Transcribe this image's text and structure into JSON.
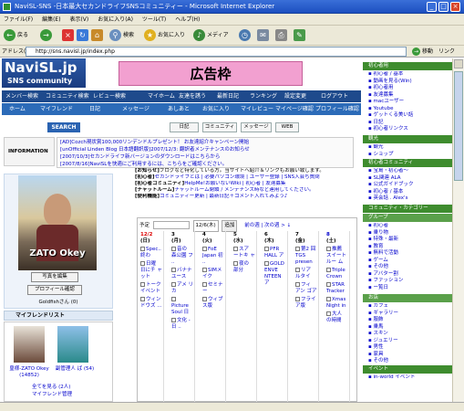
{
  "window": {
    "title": "NaviSL-SNS -日本最大セカンドライフSNSコミュニティー - Microsoft Internet Explorer"
  },
  "menu": [
    "ファイル(F)",
    "編集(E)",
    "表示(V)",
    "お気に入り(A)",
    "ツール(T)",
    "ヘルプ(H)"
  ],
  "toolbar": {
    "back": "戻る",
    "search": "検索",
    "favorites": "お気に入り",
    "media": "メディア"
  },
  "address": {
    "label": "アドレス(D)",
    "value": "http://sns.navisl.jp/index.php",
    "go": "移動",
    "links": "リンク"
  },
  "logo": {
    "title": "NaviSL.jp",
    "subtitle": "SNS community"
  },
  "ad": {
    "label": "広告枠"
  },
  "nav1": [
    "メンバー検索",
    "コミュニティ検索",
    "レビュー検索",
    "マイホーム",
    "友達を誘う",
    "最新日記",
    "ランキング",
    "設定変更",
    "ログアウト"
  ],
  "nav2": [
    "ホーム",
    "マイフレンド",
    "日記",
    "メッセージ",
    "あしあと",
    "お気に入り",
    "マイレビュー",
    "マイページ確認",
    "プロフィール確認"
  ],
  "search": {
    "button": "SEARCH",
    "tabs": [
      "日記",
      "コミュニティ",
      "メッセージ",
      "WEB"
    ]
  },
  "info": {
    "label": "INFORMATION"
  },
  "news": [
    "[AD]Cozch現状賞100,000リンデンドルプレゼント！ お友達紹介キャンペーン開始",
    "[unOfficial Linden Blog 日本語翻訳版]2007/12/3: 翻訳者メンテナンスのお知らせ",
    "[2007/10/3]セカンドライフ新バージョンのダウンロードはこちらから",
    "[2007/8/16]NaviSLを快適にご利用するには、こちらをご確認ください。"
  ],
  "profile": {
    "name": "ZATO Okey",
    "edit_photo": "写真を編集",
    "edit_profile": "プロフィール確認",
    "owner": "Goldfishさん (0)"
  },
  "friends": {
    "header": "マイフレンドリスト",
    "items": [
      {
        "label": "皇様-ZATO Okey (14852)"
      },
      {
        "label": "副管理人 ば (54)"
      }
    ],
    "see_all": "全てを見る (2人)",
    "manage": "マイフレンド管理"
  },
  "intro": [
    {
      "prefix": "[お知らせ]",
      "text": "ブログなど特化している方。当サイトへ紹介＆リンクもお願い致します。"
    },
    {
      "prefix": "[初心者]",
      "text": "セカンドライフとは | 必要パソコン環境 | ユーザー登録 | SNS入会ち質問"
    },
    {
      "prefix": "[初心者コミュニティ]",
      "text": "HelpMe!お願いないWiki | 初心者 | 友達募集"
    },
    {
      "prefix": "[チャットルーム]",
      "text": "チャットルーム閉鎖 / メンテナンス時など連用してください。"
    },
    {
      "prefix": "[便利機能]",
      "text": "コミュニティー更新 | 最新日記＋コメント入れてみよう♪"
    }
  ],
  "calendar": {
    "label": "予定",
    "select": "12/6(木)",
    "add": "追加",
    "nav": "前の週 | 次の週 > ↓",
    "days": [
      {
        "date": "12/2",
        "dow": "(日)",
        "items": [
          "Spec.. 終わ",
          "日曜 日にチ ャット",
          "トーク イベント",
          "ウィン ドウズ ..."
        ]
      },
      {
        "date": "3",
        "dow": "(月)",
        "items": [
          "音の 森公園 フ ..",
          "バナナ ユース",
          "アメ リカ",
          "Picture Soul 日",
          "文化 - 日 .."
        ]
      },
      {
        "date": "4",
        "dow": "(火)",
        "items": [
          "FoE Japan 初 ..",
          "SIMメ イク",
          "セミナ ー",
          "ウィブ ス版"
        ]
      },
      {
        "date": "5",
        "dow": "(水)",
        "items": [
          "スア ートキ ャ",
          "夜の 部分"
        ]
      },
      {
        "date": "6",
        "dow": "(木)",
        "items": [
          "PFR HALL ア",
          "GOLD ENVE NTEEN ア"
        ]
      },
      {
        "date": "7",
        "dow": "(金)",
        "items": [
          "第2 回TGS presen",
          "リア ルタイ",
          "フィ アン ゴア",
          "フライ ア版"
        ]
      },
      {
        "date": "8",
        "dow": "(土)",
        "items": [
          "推薦 スイート ルー ム",
          "Triple Crown",
          "STAR Tracker",
          "Xmas Night in",
          "大人 の時間"
        ]
      }
    ]
  },
  "right": {
    "sec1": "初心者用",
    "sec1_items": [
      "初心者 / 基本",
      "動画を見る(Win)",
      "初心者用",
      "友達募集",
      "macユーザー",
      "Youtube",
      "ゲットくる美い話",
      "日記",
      "初心者リンクス"
    ],
    "sec2": "観光",
    "sec2_items": [
      "観光",
      "ショップ"
    ],
    "sec3": "初心者コミュニティ",
    "sec3_items": [
      "宝島・初心者～",
      "SL関連 ALA",
      "公式ガイドブック",
      "初心者 / 基本",
      "英会話 . Alex's"
    ],
    "sec4": "コミュニティ・カテゴリー",
    "sec4a": "グループ",
    "sec4a_items": [
      "初心者",
      "乗り物",
      "特殊・最新",
      "教育",
      "無料で活動",
      "ゲーム",
      "その他",
      "アバター割",
      "ファッション",
      "ー覧日"
    ],
    "sec4b": "お店",
    "sec4b_items": [
      "カフェ",
      "ギャラリー",
      "服飾",
      "乗馬",
      "スキン",
      "ジュエリー",
      "男性",
      "家具",
      "その他"
    ],
    "sec5": "イベント",
    "sec5_items": [
      "in-world イベント"
    ]
  }
}
